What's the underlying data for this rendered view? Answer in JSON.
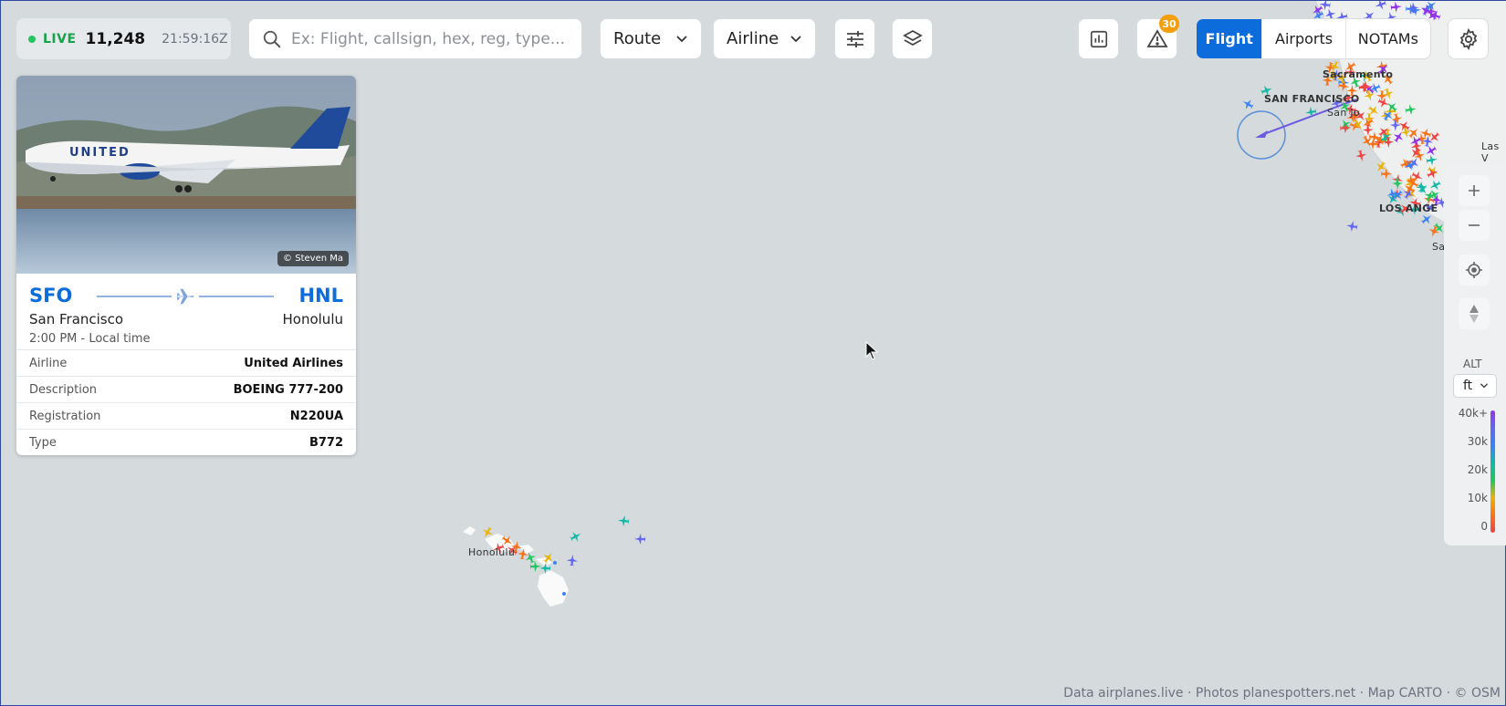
{
  "status": {
    "live_label": "LIVE",
    "count": "11,248",
    "time": "21:59:16Z"
  },
  "search": {
    "placeholder": "Ex: Flight, callsign, hex, reg, type..."
  },
  "filters": {
    "route": "Route",
    "airline": "Airline"
  },
  "alerts": {
    "count": "30"
  },
  "modes": {
    "flight": "Flight",
    "airports": "Airports",
    "notams": "NOTAMs",
    "active": "Flight"
  },
  "flight_card": {
    "photo_credit": "© Steven Ma",
    "origin": {
      "code": "SFO",
      "city": "San Francisco"
    },
    "destination": {
      "code": "HNL",
      "city": "Honolulu"
    },
    "departure_time": "2:00 PM - Local time",
    "details": [
      {
        "label": "Airline",
        "value": "United Airlines"
      },
      {
        "label": "Description",
        "value": "BOEING 777-200"
      },
      {
        "label": "Registration",
        "value": "N220UA"
      },
      {
        "label": "Type",
        "value": "B772"
      }
    ]
  },
  "altitude_legend": {
    "title": "ALT",
    "unit": "ft",
    "ticks": [
      "40k+",
      "30k",
      "20k",
      "10k",
      "0"
    ]
  },
  "map_labels": {
    "sacramento": "Sacramento",
    "san_francisco": "SAN FRANCISCO",
    "san_jose": "San Jo",
    "los_angeles": "LOS ANGE",
    "las_vegas": "Las V",
    "san_diego": "Sa",
    "honolulu": "Honolulu"
  },
  "footer": {
    "attribution": "Data airplanes.live · Photos planespotters.net · Map CARTO · © OSM"
  },
  "colors": {
    "accent": "#0d6cdc",
    "live": "#16a34a",
    "badge": "#f59e0b",
    "map_bg": "#d5dadd"
  }
}
